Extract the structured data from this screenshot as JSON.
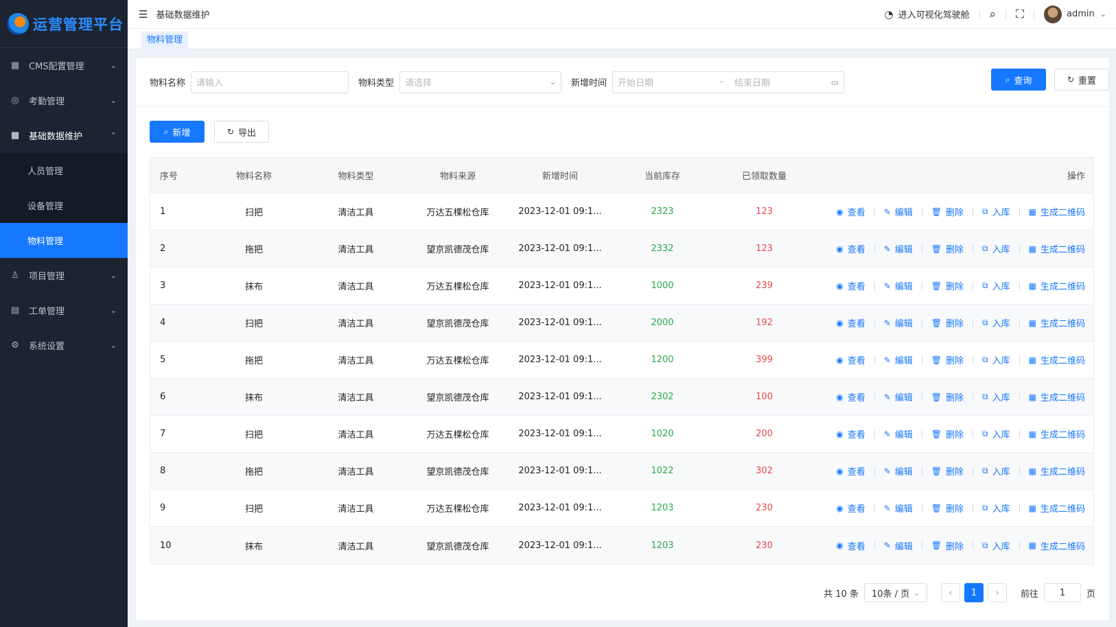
{
  "app": {
    "title": "运营管理平台"
  },
  "sidebar": {
    "menus": [
      {
        "label": "CMS配置管理",
        "icon": "grid-icon"
      },
      {
        "label": "考勤管理",
        "icon": "location-icon"
      },
      {
        "label": "基础数据维护",
        "icon": "grid-icon",
        "open": true,
        "children": [
          {
            "label": "人员管理"
          },
          {
            "label": "设备管理"
          },
          {
            "label": "物料管理",
            "active": true
          }
        ]
      },
      {
        "label": "项目管理",
        "icon": "user-icon"
      },
      {
        "label": "工单管理",
        "icon": "document-icon"
      },
      {
        "label": "系统设置",
        "icon": "gear-icon"
      }
    ]
  },
  "header": {
    "breadcrumb": "基础数据维护",
    "cockpit": "进入可视化驾驶舱",
    "username": "admin"
  },
  "tags": {
    "active": "物料管理"
  },
  "filters": {
    "name_label": "物料名称",
    "name_placeholder": "请输入",
    "type_label": "物料类型",
    "type_placeholder": "请选择",
    "time_label": "新增时间",
    "start_placeholder": "开始日期",
    "range_sep": "–",
    "end_placeholder": "结束日期",
    "query_label": "查询",
    "reset_label": "重置"
  },
  "toolbar": {
    "add_label": "新增",
    "export_label": "导出"
  },
  "table": {
    "columns": [
      "序号",
      "物料名称",
      "物料类型",
      "物料来源",
      "新增时间",
      "当前库存",
      "已领取数量",
      "操作"
    ],
    "ops": [
      "查看",
      "编辑",
      "删除",
      "入库",
      "生成二维码"
    ],
    "rows": [
      {
        "idx": "1",
        "name": "扫把",
        "type": "清洁工具",
        "source": "万达五棵松仓库",
        "time": "2023-12-01 09:1...",
        "stock": "2323",
        "received": "123"
      },
      {
        "idx": "2",
        "name": "拖把",
        "type": "清洁工具",
        "source": "望京凯德茂仓库",
        "time": "2023-12-01 09:1...",
        "stock": "2332",
        "received": "123"
      },
      {
        "idx": "3",
        "name": "抹布",
        "type": "清洁工具",
        "source": "万达五棵松仓库",
        "time": "2023-12-01 09:1...",
        "stock": "1000",
        "received": "239"
      },
      {
        "idx": "4",
        "name": "扫把",
        "type": "清洁工具",
        "source": "望京凯德茂仓库",
        "time": "2023-12-01 09:1...",
        "stock": "2000",
        "received": "192"
      },
      {
        "idx": "5",
        "name": "拖把",
        "type": "清洁工具",
        "source": "万达五棵松仓库",
        "time": "2023-12-01 09:1...",
        "stock": "1200",
        "received": "399"
      },
      {
        "idx": "6",
        "name": "抹布",
        "type": "清洁工具",
        "source": "望京凯德茂仓库",
        "time": "2023-12-01 09:1...",
        "stock": "2302",
        "received": "100"
      },
      {
        "idx": "7",
        "name": "扫把",
        "type": "清洁工具",
        "source": "万达五棵松仓库",
        "time": "2023-12-01 09:1...",
        "stock": "1020",
        "received": "200"
      },
      {
        "idx": "8",
        "name": "拖把",
        "type": "清洁工具",
        "source": "望京凯德茂仓库",
        "time": "2023-12-01 09:1...",
        "stock": "1022",
        "received": "302"
      },
      {
        "idx": "9",
        "name": "扫把",
        "type": "清洁工具",
        "source": "万达五棵松仓库",
        "time": "2023-12-01 09:1...",
        "stock": "1203",
        "received": "230"
      },
      {
        "idx": "10",
        "name": "抹布",
        "type": "清洁工具",
        "source": "望京凯德茂仓库",
        "time": "2023-12-01 09:1...",
        "stock": "1203",
        "received": "230"
      }
    ]
  },
  "pagination": {
    "total_text": "共 10 条",
    "page_size": "10条 / 页",
    "current": "1",
    "goto_label": "前往",
    "goto_value": "1",
    "page_suffix": "页"
  },
  "colors": {
    "primary": "#1677ff",
    "stock": "#2ba84a",
    "received": "#e5484d",
    "sidebar": "#1c2431"
  }
}
